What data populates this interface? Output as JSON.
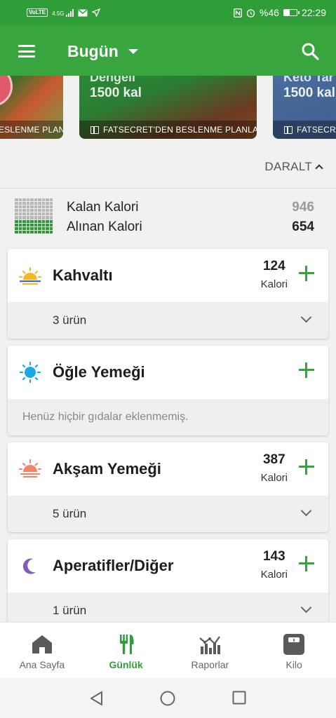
{
  "status_bar": {
    "volte": "VoLTE",
    "network": "4.5G",
    "battery": "%46",
    "time": "22:29",
    "battery_level": 0.46
  },
  "app_bar": {
    "title": "Bugün",
    "menu_icon": "menu-icon",
    "dropdown_icon": "caret-down-icon",
    "search_icon": "search-icon"
  },
  "carousel": {
    "cards": [
      {
        "title": "",
        "kcal": "",
        "footer": "ESLENME PLANLA"
      },
      {
        "title": "Dengeli",
        "kcal": "1500 kal",
        "footer": "FATSECRET'DEN BESLENME PLANLA"
      },
      {
        "title": "Keto Tar",
        "kcal": "1500 kal",
        "footer": "FATSECRET"
      }
    ]
  },
  "collapse_label": "DARALT",
  "summary": {
    "remaining_label": "Kalan Kalori",
    "remaining_value": "946",
    "consumed_label": "Alınan Kalori",
    "consumed_value": "654",
    "progress_fraction": 0.41
  },
  "meals": {
    "breakfast": {
      "title": "Kahvaltı",
      "kcal": "124",
      "unit": "Kalori",
      "items": "3 ürün",
      "icon": "sunrise-icon"
    },
    "lunch": {
      "title": "Öğle Yemeği",
      "empty_text": "Henüz hiçbir gıdalar eklenmemiş.",
      "icon": "sun-icon"
    },
    "dinner": {
      "title": "Akşam Yemeği",
      "kcal": "387",
      "unit": "Kalori",
      "items": "5 ürün",
      "icon": "sunset-icon"
    },
    "snacks": {
      "title": "Aperatifler/Diğer",
      "kcal": "143",
      "unit": "Kalori",
      "items": "1 ürün",
      "icon": "moon-icon"
    }
  },
  "bottom_nav": {
    "items": [
      {
        "label": "Ana Sayfa",
        "icon": "home-icon"
      },
      {
        "label": "Günlük",
        "icon": "fork-knife-icon",
        "active": true
      },
      {
        "label": "Raporlar",
        "icon": "chart-icon"
      },
      {
        "label": "Kilo",
        "icon": "scale-icon"
      }
    ]
  },
  "colors": {
    "primary": "#38a53f",
    "status_bar": "#2f9e39",
    "accent_plus": "#3aa043",
    "background": "#f1f1f1"
  }
}
